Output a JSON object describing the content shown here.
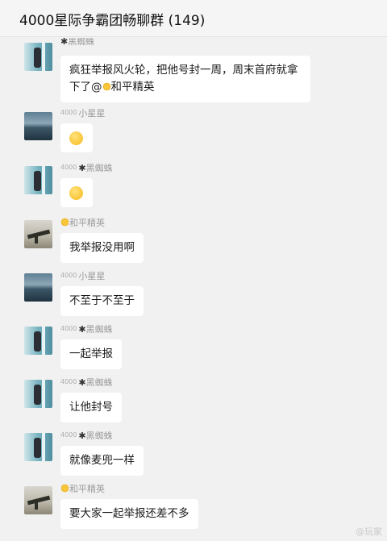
{
  "header": {
    "title": "4000星际争霸团畅聊群 (149)"
  },
  "messages": [
    {
      "sender_prefix": "",
      "sender_name": "黑蜘蛛",
      "avatar": "sea",
      "lines": [
        "疯狂举报风火轮，把他号封一周，周末首府就拿",
        "下了@",
        "和平精英"
      ]
    },
    {
      "sender_prefix": "4000",
      "sender_name": "小星星",
      "avatar": "lake",
      "emoji": "laughing-emoji"
    },
    {
      "sender_prefix": "4000",
      "sender_name": "黑蜘蛛",
      "avatar": "sea",
      "emoji": "wink-emoji"
    },
    {
      "sender_prefix": "",
      "sender_name": "和平精英",
      "avatar": "gun",
      "text": "我举报没用啊"
    },
    {
      "sender_prefix": "4000",
      "sender_name": "小星星",
      "avatar": "lake",
      "text": "不至于不至于"
    },
    {
      "sender_prefix": "4000",
      "sender_name": "黑蜘蛛",
      "avatar": "sea",
      "text": "一起举报"
    },
    {
      "sender_prefix": "4000",
      "sender_name": "黑蜘蛛",
      "avatar": "sea",
      "text": "让他封号"
    },
    {
      "sender_prefix": "4000",
      "sender_name": "黑蜘蛛",
      "avatar": "sea",
      "text": "就像麦兜一样"
    },
    {
      "sender_prefix": "",
      "sender_name": "和平精英",
      "avatar": "gun",
      "text": "要大家一起举报还差不多"
    }
  ],
  "watermark": "@玩家"
}
